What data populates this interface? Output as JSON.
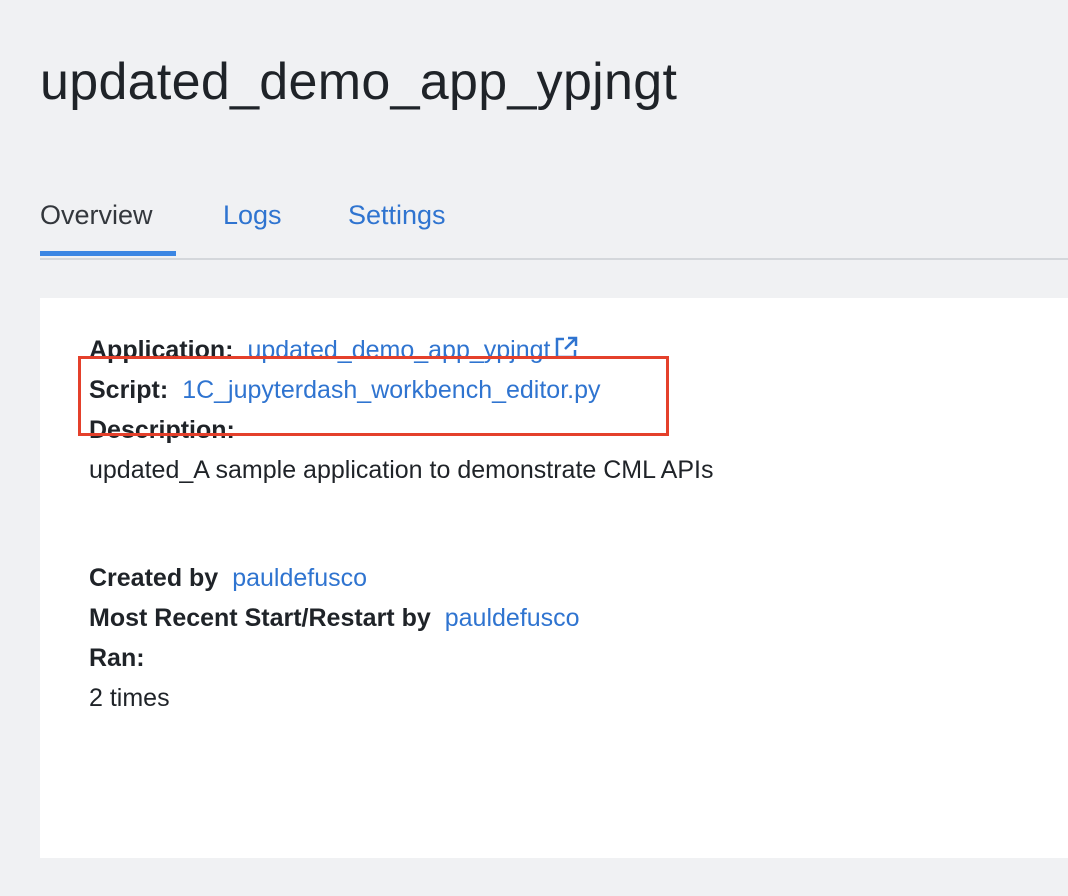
{
  "header": {
    "title": "updated_demo_app_ypjngt"
  },
  "tabs": [
    {
      "label": "Overview",
      "active": true
    },
    {
      "label": "Logs",
      "active": false
    },
    {
      "label": "Settings",
      "active": false
    }
  ],
  "details": {
    "application_label": "Application:",
    "application_value": "updated_demo_app_ypjngt",
    "application_icon": "external-link-icon",
    "script_label": "Script:",
    "script_value": "1C_jupyterdash_workbench_editor.py",
    "description_label": "Description:",
    "description_value": "updated_A sample application to demonstrate CML APIs",
    "created_by_label": "Created by",
    "created_by_value": "pauldefusco",
    "restart_by_label": "Most Recent Start/Restart by",
    "restart_by_value": "pauldefusco",
    "ran_label": "Ran:",
    "ran_value": "2 times"
  },
  "colors": {
    "link": "#2f74d0",
    "highlight": "#e4402b",
    "tab_underline": "#3b86e3"
  }
}
